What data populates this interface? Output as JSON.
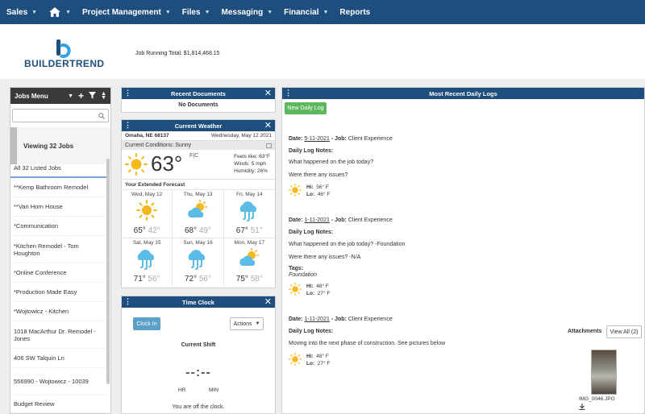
{
  "nav": {
    "items": [
      {
        "label": "Sales",
        "caret": true
      },
      {
        "label": "",
        "caret": true,
        "icon": "home-icon"
      },
      {
        "label": "Project Management",
        "caret": true
      },
      {
        "label": "Files",
        "caret": true
      },
      {
        "label": "Messaging",
        "caret": true
      },
      {
        "label": "Financial",
        "caret": true
      },
      {
        "label": "Reports",
        "caret": false
      }
    ]
  },
  "brand": {
    "name": "BUILDERTREND"
  },
  "header": {
    "running_total": "Job Running Total: $1,814,468.15"
  },
  "jobs": {
    "title": "Jobs Menu",
    "viewing": "Viewing 32 Jobs",
    "items": [
      "All 32 Listed Jobs",
      "**Kemp Bathroom Remodel",
      "**Van Horn House",
      "*Communication",
      "*Kitchen Remodel - Tom Houghton",
      "*Online Conference",
      "*Production Made Easy",
      "*Wojtowicz - Kitchen",
      "1018 MacArthur Dr. Remodel - Jones",
      "406 SW Talquin Ln",
      "556990 - Wojtowicz - 10039",
      "Budget Review"
    ]
  },
  "recent_docs": {
    "title": "Recent Documents",
    "empty": "No Documents"
  },
  "weather": {
    "title": "Current Weather",
    "location": "Omaha, NE 68137",
    "date": "Wednesday, May 12 2021",
    "conditions": "Current Conditions: Sunny",
    "temp": "63°",
    "unit": "F|C",
    "feels": "Feels like: 63°F",
    "winds": "Winds: 5 mph",
    "humidity": "Humidity: 26%",
    "extended_label": "Your Extended Forecast",
    "forecast": [
      {
        "day": "Wed, May 12",
        "hi": "65°",
        "lo": "42°",
        "icon": "sun-icon"
      },
      {
        "day": "Thu, May 13",
        "hi": "68°",
        "lo": "49°",
        "icon": "partly-cloudy-icon"
      },
      {
        "day": "Fri, May 14",
        "hi": "67°",
        "lo": "51°",
        "icon": "wind-icon"
      },
      {
        "day": "Sat, May 15",
        "hi": "71°",
        "lo": "56°",
        "icon": "wind-icon"
      },
      {
        "day": "Sun, May 16",
        "hi": "72°",
        "lo": "56°",
        "icon": "wind-icon"
      },
      {
        "day": "Mon, May 17",
        "hi": "75°",
        "lo": "58°",
        "icon": "partly-cloudy-icon"
      }
    ]
  },
  "time_clock": {
    "title": "Time Clock",
    "clock_in": "Clock In",
    "actions": "Actions",
    "current_shift": "Current Shift",
    "time": "--:--",
    "hr": "HR",
    "min": "MIN",
    "status": "You are off the clock."
  },
  "daily_logs": {
    "title": "Most Recent Daily Logs",
    "new_button": "New Daily Log",
    "attachments_label": "Attachments",
    "view_all": "View All (2)",
    "attachment_name": "IMG_0046.JPG",
    "logs": [
      {
        "date_label": "Date:",
        "date": "5-11-2021",
        "job_label": "- Job:",
        "job": "Client Experience",
        "notes_label": "Daily Log Notes:",
        "q1": "What happened on the job today?",
        "q2": "Were there any issues?",
        "tags_label": "",
        "tags": "",
        "hi": "Hi:",
        "hi_val": "56° F",
        "lo": "Lo:",
        "lo_val": "46° F"
      },
      {
        "date_label": "Date:",
        "date": "1-11-2021",
        "job_label": "- Job:",
        "job": "Client Experience",
        "notes_label": "Daily Log Notes:",
        "q1": "What happened on the job today? -Foundation",
        "q2": "Were there any issues? -N/A",
        "tags_label": "Tags:",
        "tags": "Foundation",
        "hi": "Hi:",
        "hi_val": "48° F",
        "lo": "Lo:",
        "lo_val": "27° F"
      },
      {
        "date_label": "Date:",
        "date": "1-11-2021",
        "job_label": "- Job:",
        "job": "Client Experience",
        "notes_label": "Daily Log Notes:",
        "q1": "Moving into the next phase of construction. See pictures below",
        "q2": "",
        "tags_label": "",
        "tags": "",
        "hi": "Hi:",
        "hi_val": "48° F",
        "lo": "Lo:",
        "lo_val": "27° F"
      }
    ]
  },
  "colors": {
    "nav": "#1e4e7d",
    "sun": "#f5b81c",
    "cloud": "#5bbde6",
    "green": "#5cb85c"
  }
}
